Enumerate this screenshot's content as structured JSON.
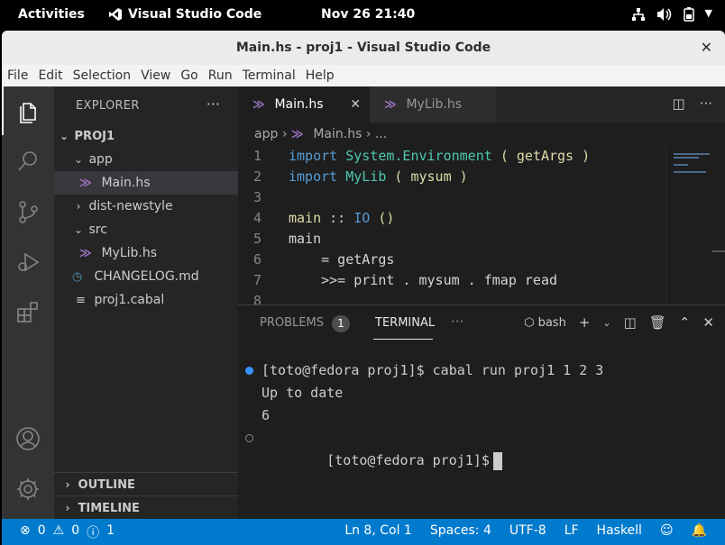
{
  "topbar": {
    "activities": "Activities",
    "app_name": "Visual Studio Code",
    "clock": "Nov 26  21:40"
  },
  "window": {
    "title": "Main.hs - proj1 - Visual Studio Code",
    "close_icon": "close-icon"
  },
  "menubar": [
    "File",
    "Edit",
    "Selection",
    "View",
    "Go",
    "Run",
    "Terminal",
    "Help"
  ],
  "sidebar": {
    "title": "EXPLORER",
    "more": "···",
    "tree": [
      {
        "label": "PROJ1",
        "kind": "root"
      },
      {
        "label": "app",
        "kind": "folder-open"
      },
      {
        "label": "Main.hs",
        "kind": "haskell",
        "selected": true
      },
      {
        "label": "dist-newstyle",
        "kind": "folder-closed"
      },
      {
        "label": "src",
        "kind": "folder-open"
      },
      {
        "label": "MyLib.hs",
        "kind": "haskell"
      },
      {
        "label": "CHANGELOG.md",
        "kind": "markdown"
      },
      {
        "label": "proj1.cabal",
        "kind": "cabal"
      }
    ],
    "outline": "OUTLINE",
    "timeline": "TIMELINE"
  },
  "tabs": [
    {
      "label": "Main.hs",
      "active": true
    },
    {
      "label": "MyLib.hs",
      "active": false
    }
  ],
  "breadcrumb": {
    "folder": "app",
    "file": "Main.hs",
    "more": "..."
  },
  "code": [
    {
      "n": "1",
      "tokens": [
        [
          "kw",
          "import"
        ],
        [
          "pl",
          " "
        ],
        [
          "mod",
          "System.Environment"
        ],
        [
          "pl",
          " "
        ],
        [
          "fn",
          "("
        ],
        [
          "pl",
          " "
        ],
        [
          "fn",
          "getArgs"
        ],
        [
          "pl",
          " "
        ],
        [
          "fn",
          ")"
        ]
      ]
    },
    {
      "n": "2",
      "tokens": [
        [
          "kw",
          "import"
        ],
        [
          "pl",
          " "
        ],
        [
          "mod",
          "MyLib"
        ],
        [
          "pl",
          " "
        ],
        [
          "fn",
          "("
        ],
        [
          "pl",
          " "
        ],
        [
          "fn",
          "mysum"
        ],
        [
          "pl",
          " "
        ],
        [
          "fn",
          ")"
        ]
      ]
    },
    {
      "n": "3",
      "tokens": []
    },
    {
      "n": "4",
      "tokens": [
        [
          "fn",
          "main"
        ],
        [
          "pl",
          " :: "
        ],
        [
          "kw",
          "IO"
        ],
        [
          "pl",
          " "
        ],
        [
          "fn",
          "()"
        ]
      ]
    },
    {
      "n": "5",
      "tokens": [
        [
          "pl",
          "main"
        ]
      ]
    },
    {
      "n": "6",
      "tokens": [
        [
          "pl",
          "    = getArgs"
        ]
      ]
    },
    {
      "n": "7",
      "tokens": [
        [
          "pl",
          "    >>= print . mysum . fmap read"
        ]
      ]
    },
    {
      "n": "8",
      "tokens": []
    }
  ],
  "panel": {
    "problems": "PROBLEMS",
    "problems_count": "1",
    "terminal": "TERMINAL",
    "more": "···",
    "shell": "bash",
    "lines": [
      "[toto@fedora proj1]$ cabal run proj1 1 2 3",
      "Up to date",
      "6",
      "[toto@fedora proj1]$"
    ]
  },
  "statusbar": {
    "errors": "0",
    "warnings": "0",
    "info": "1",
    "position": "Ln 8, Col 1",
    "spaces": "Spaces: 4",
    "encoding": "UTF-8",
    "eol": "LF",
    "language": "Haskell"
  }
}
